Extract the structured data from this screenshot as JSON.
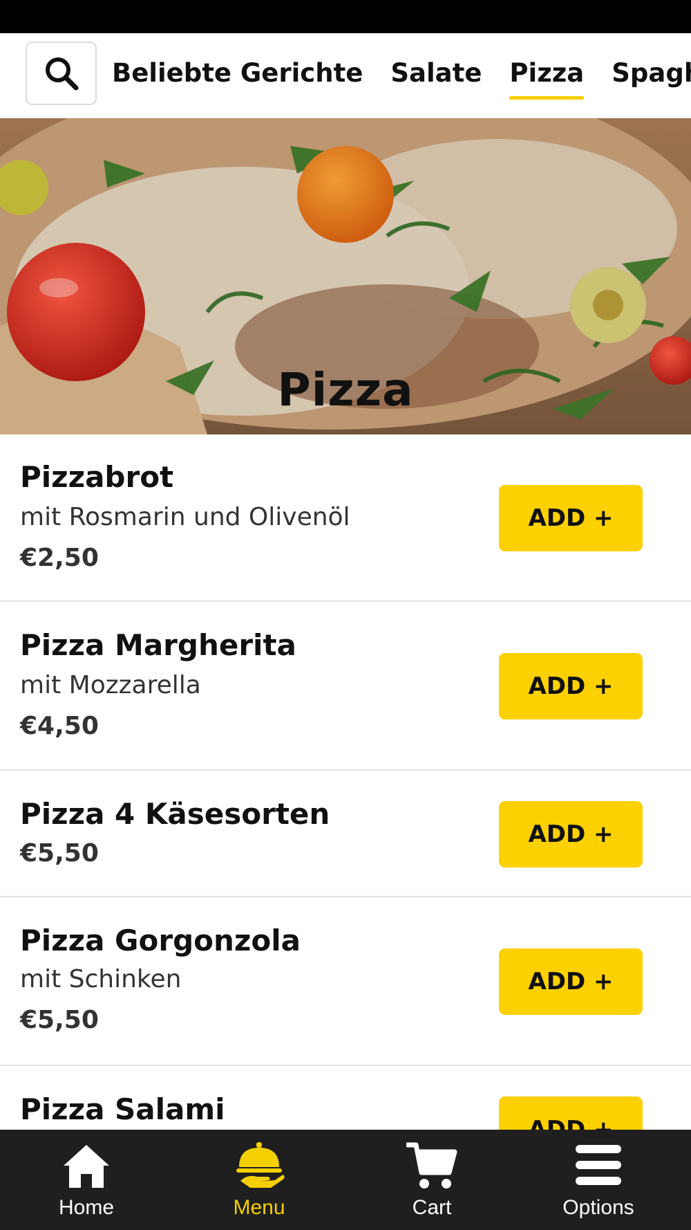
{
  "categories": {
    "search_icon": "search-icon",
    "tabs": [
      {
        "label": "Beliebte Gerichte",
        "active": false
      },
      {
        "label": "Salate",
        "active": false
      },
      {
        "label": "Pizza",
        "active": true
      },
      {
        "label": "Spaghetti",
        "active": false
      }
    ]
  },
  "hero": {
    "title": "Pizza",
    "image": "pizza-photo"
  },
  "items": [
    {
      "name": "Pizzabrot",
      "description": "mit Rosmarin und Olivenöl",
      "price": "€2,50",
      "add_label": "ADD +"
    },
    {
      "name": "Pizza Margherita",
      "description": "mit Mozzarella",
      "price": "€4,50",
      "add_label": "ADD +"
    },
    {
      "name": "Pizza 4 Käsesorten",
      "description": "",
      "price": "€5,50",
      "add_label": "ADD +"
    },
    {
      "name": "Pizza Gorgonzola",
      "description": "mit Schinken",
      "price": "€5,50",
      "add_label": "ADD +"
    },
    {
      "name": "Pizza Salami",
      "description": "",
      "price": "",
      "add_label": "ADD +"
    }
  ],
  "bottom_nav": [
    {
      "label": "Home",
      "icon": "home-icon",
      "active": false
    },
    {
      "label": "Menu",
      "icon": "serving-cloche-icon",
      "active": true
    },
    {
      "label": "Cart",
      "icon": "cart-icon",
      "active": false
    },
    {
      "label": "Options",
      "icon": "hamburger-menu-icon",
      "active": false
    }
  ],
  "colors": {
    "accent": "#fdd000",
    "nav_background": "#1f1f1f",
    "status_bar": "#000000"
  }
}
